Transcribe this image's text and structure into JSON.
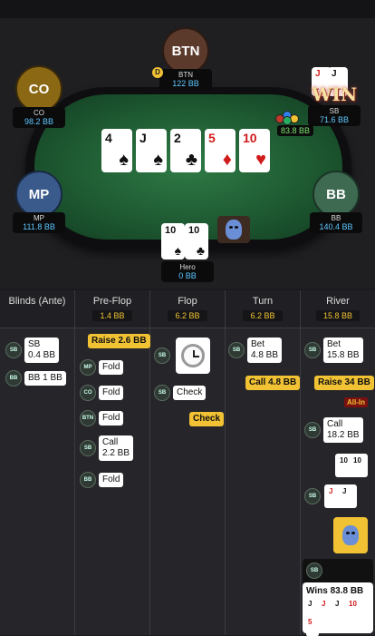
{
  "seats": {
    "btn": {
      "label": "BTN",
      "name": "BTN",
      "stack": "122 BB"
    },
    "co": {
      "label": "CO",
      "name": "CO",
      "stack": "98.2 BB"
    },
    "sb": {
      "name": "SB",
      "stack": "71.6 BB"
    },
    "mp": {
      "label": "MP",
      "name": "MP",
      "stack": "111.8 BB"
    },
    "bb": {
      "label": "BB",
      "name": "BB",
      "stack": "140.4 BB"
    },
    "hero": {
      "name": "Hero",
      "stack": "0 BB"
    }
  },
  "dealer_label": "D",
  "win_text": "WIN",
  "pot": "83.8 BB",
  "board": [
    {
      "rank": "4",
      "suit": "♠",
      "color": "black"
    },
    {
      "rank": "J",
      "suit": "♠",
      "color": "black"
    },
    {
      "rank": "2",
      "suit": "♣",
      "color": "black"
    },
    {
      "rank": "5",
      "suit": "♦",
      "color": "red"
    },
    {
      "rank": "10",
      "suit": "♥",
      "color": "red"
    }
  ],
  "hero_cards": [
    {
      "rank": "10",
      "suit": "♠"
    },
    {
      "rank": "10",
      "suit": "♣"
    }
  ],
  "sb_cards": [
    {
      "rank": "J",
      "suit": "♥"
    },
    {
      "rank": "J",
      "suit": "♣"
    }
  ],
  "history": {
    "columns": [
      {
        "title": "Blinds (Ante)",
        "pot": ""
      },
      {
        "title": "Pre-Flop",
        "pot": "1.4 BB"
      },
      {
        "title": "Flop",
        "pot": "6.2 BB"
      },
      {
        "title": "Turn",
        "pot": "6.2 BB"
      },
      {
        "title": "River",
        "pot": "15.8 BB"
      }
    ],
    "blinds": [
      {
        "pos": "SB",
        "text": "SB\n0.4 BB"
      },
      {
        "pos": "BB",
        "text": "BB 1 BB"
      }
    ],
    "preflop": [
      {
        "pos": "",
        "text": "Raise 2.6 BB",
        "style": "gold"
      },
      {
        "pos": "MP",
        "text": "Fold"
      },
      {
        "pos": "CO",
        "text": "Fold"
      },
      {
        "pos": "BTN",
        "text": "Fold"
      },
      {
        "pos": "SB",
        "text": "Call\n2.2 BB"
      },
      {
        "pos": "BB",
        "text": "Fold"
      }
    ],
    "flop": [
      {
        "pos": "SB",
        "text": ""
      },
      {
        "pos": "SB",
        "text": "Check"
      },
      {
        "pos": "",
        "text": "Check",
        "style": "gold"
      }
    ],
    "turn": [
      {
        "pos": "SB",
        "text": "Bet\n4.8 BB"
      },
      {
        "pos": "",
        "text": "Call 4.8 BB",
        "style": "gold"
      }
    ],
    "river": [
      {
        "pos": "SB",
        "text": "Bet\n15.8 BB"
      },
      {
        "pos": "",
        "text": "Raise 34 BB",
        "style": "gold"
      },
      {
        "pos": "SB",
        "text": "Call\n18.2 BB"
      }
    ],
    "allin_label": "All-In",
    "wins_text": "Wins 83.8 BB",
    "wins_cards": [
      {
        "rank": "J",
        "suit": "♠"
      },
      {
        "rank": "J",
        "suit": "♥"
      },
      {
        "rank": "J",
        "suit": "♣"
      },
      {
        "rank": "10",
        "suit": "♥"
      },
      {
        "rank": "5",
        "suit": "♦"
      }
    ]
  },
  "colors": {
    "accent": "#f1c233",
    "stack_blue": "#5ec8ff",
    "pot_green": "#7fe36f",
    "felt": "#2f7a45"
  }
}
